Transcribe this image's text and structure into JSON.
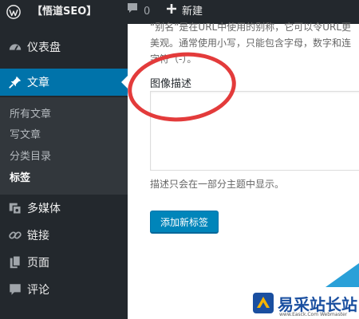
{
  "adminbar": {
    "site_name": "【悟道SEO】",
    "comments_count": "0",
    "new_label": "新建"
  },
  "sidebar": {
    "dashboard": "仪表盘",
    "posts": "文章",
    "submenu": [
      "所有文章",
      "写文章",
      "分类目录",
      "标签"
    ],
    "media": "多媒体",
    "links": "链接",
    "pages": "页面",
    "comments": "评论"
  },
  "form": {
    "slug_description": "“别名”是在URL中使用的别称，它可以令URL更美观。通常使用小写，只能包含字母，数字和连字符（-）。",
    "description_label": "图像描述",
    "description_value": "",
    "description_hint": "描述只会在一部分主题中显示。",
    "add_button": "添加新标签"
  },
  "watermark": {
    "text": "易采站长站",
    "url": "www.Easck.Com Webmaster"
  },
  "colors": {
    "admin_bg": "#23282d",
    "accent": "#0073aa",
    "button": "#0085ba",
    "annotation": "#e33b3b"
  }
}
